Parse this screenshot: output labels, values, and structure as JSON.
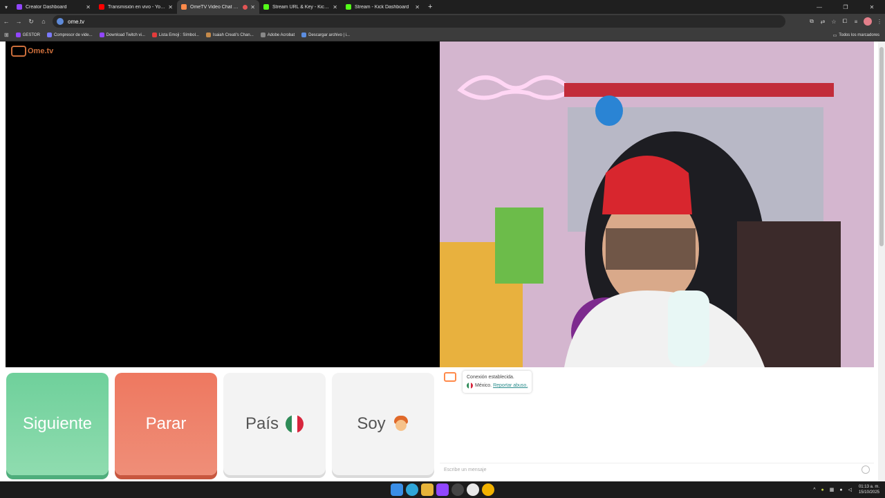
{
  "browser": {
    "tabs": [
      {
        "title": "Creator Dashboard",
        "color": "#9146ff",
        "active": false
      },
      {
        "title": "Transmisión en vivo - YouTube",
        "color": "#ff0000",
        "active": false
      },
      {
        "title": "OmeTV Video Chat — Ome",
        "color": "#ff8a4a",
        "active": true
      },
      {
        "title": "Stream URL & Key - Kick Dash",
        "color": "#53fc18",
        "active": false
      },
      {
        "title": "Stream - Kick Dashboard",
        "color": "#53fc18",
        "active": false
      }
    ],
    "url": "ome.tv",
    "bookmarks": [
      {
        "label": "GESTOR",
        "color": "#9146ff"
      },
      {
        "label": "Compresor de vide...",
        "color": "#7a7aff"
      },
      {
        "label": "Download Twitch vi...",
        "color": "#9146ff"
      },
      {
        "label": "Lista Emoji : Símbol...",
        "color": "#e33b3b"
      },
      {
        "label": "Isaiah Creati's Chan...",
        "color": "#c58a4a"
      },
      {
        "label": "Adobe Acrobat",
        "color": "#888888"
      },
      {
        "label": "Descargar archivo | i...",
        "color": "#5b8de0"
      }
    ],
    "all_bookmarks": "Todos los marcadores"
  },
  "ometv": {
    "logo_text": "Ome.tv",
    "buttons": {
      "next": "Siguiente",
      "stop": "Parar",
      "country": "País",
      "soy": "Soy"
    },
    "chat": {
      "status": "Conexión establecida.",
      "country": "México.",
      "report": "Reportar abuso.",
      "placeholder": "Escribe un mensaje"
    }
  },
  "taskbar": {
    "time": "01:13 a. m.",
    "date": "15/10/2025"
  }
}
